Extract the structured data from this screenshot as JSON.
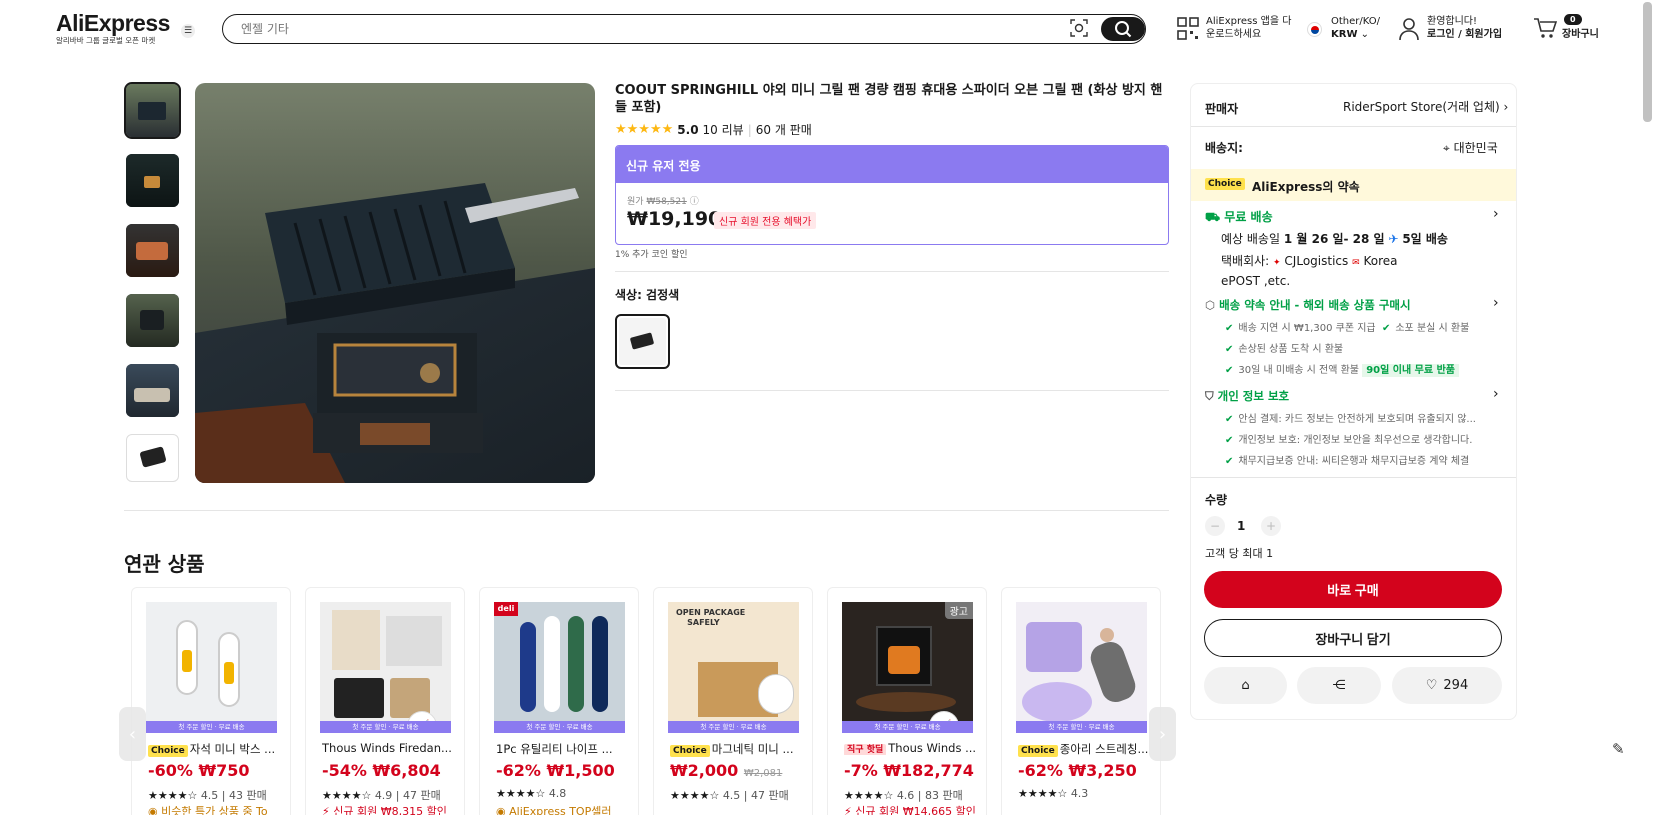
{
  "header": {
    "logo": "AliExpress",
    "logo_sub": "알리바바 그룹 글로벌 오픈 마켓",
    "search_placeholder": "엔젤 기타",
    "app_line1": "AliExpress 앱을 다",
    "app_line2": "운로드하세요",
    "locale_line1": "Other/KO/",
    "locale_currency": "KRW",
    "welcome": "환영합니다!",
    "login": "로그인 / 회원가입",
    "cart_count": "0",
    "cart_label": "장바구니"
  },
  "product": {
    "title": "COOUT SPRINGHILL 야외 미니 그릴 팬 경량 캠핑 휴대용 스파이더 오븐 그릴 팬 (화상 방지 핸들 포함)",
    "rating": "5.0",
    "reviews": "10 리뷰",
    "sold": "60 개 판매",
    "promo_header": "신규 유저 전용",
    "orig_label": "원가",
    "orig_price": "₩58,521",
    "price": "₩19,190",
    "price_tag": "신규 회원 전용 혜택가",
    "coin": "1% 추가 코인 할인",
    "color_label": "색상: 검정색"
  },
  "panel": {
    "seller_label": "판매자",
    "seller_name": "RiderSport Store(거래 업체)",
    "ship_to_label": "배송지:",
    "ship_to": "대한민국",
    "choice_badge": "Choice",
    "promise": "AliExpress의 약속",
    "free_ship": "무료 배송",
    "eta_prefix": "예상 배송일",
    "eta_dates": "1 월 26 일- 28 일",
    "eta_days": "5일 배송",
    "courier_label": "택배회사:",
    "courier1": "CJLogistics",
    "courier2": "Korea",
    "courier3": "ePOST ,etc.",
    "guarantee_title": "배송 약속 안내 - 해외 배송 상품 구매시",
    "g1": "배송 지연 시 ₩1,300 쿠폰 지급",
    "g2": "소포 분실 시 환불",
    "g3": "손상된 상품 도착 시 환불",
    "g4": "30일 내 미배송 시 전액 환불",
    "g4_badge": "90일 이내 무료 반품",
    "privacy_title": "개인 정보 보호",
    "p1": "안심 결제: 카드 정보는 안전하게 보호되며 유출되지 않...",
    "p2": "개인정보 보호: 개인정보 보안을 최우선으로 생각합니다.",
    "p3": "채무지급보증 안내: 씨티은행과 채무지급보증 계약 체결",
    "qty_label": "수량",
    "qty_value": "1",
    "qty_limit": "고객 당 최대 1",
    "buy_now": "바로 구매",
    "add_cart": "장바구니 담기",
    "wish_count": "294"
  },
  "related": {
    "title": "연관 상품",
    "strip": "첫 주문 할인 · 무료 배송",
    "ad_badge": "광고",
    "items": [
      {
        "choice": "Choice",
        "name": "자석 미니 박스 ...",
        "discount": "-60%",
        "price": "₩750",
        "rating": "4.5",
        "sold": "43 판매",
        "extra": "비슷한 특가 상품 중 To"
      },
      {
        "choice": "",
        "name": "Thous Winds Firedan...",
        "discount": "-54%",
        "price": "₩6,804",
        "rating": "4.9",
        "sold": "47 판매",
        "extra": "신규 회원 ₩8,315 할인"
      },
      {
        "choice": "",
        "name": "1Pc 유틸리티 나이프 ...",
        "discount": "-62%",
        "price": "₩1,500",
        "rating": "4.8",
        "sold": "",
        "extra": "AliExpress TOP셀러"
      },
      {
        "choice": "Choice",
        "name": "마그네틱 미니 ...",
        "discount": "",
        "price": "₩2,000",
        "orig": "₩2,081",
        "rating": "4.5",
        "sold": "47 판매",
        "extra": ""
      },
      {
        "choice": "직구 핫딜",
        "name": "Thous Winds ...",
        "discount": "-7%",
        "price": "₩182,774",
        "rating": "4.6",
        "sold": "83 판매",
        "extra": "신규 회원 ₩14,665 할인"
      },
      {
        "choice": "Choice",
        "name": "종아리 스트레칭...",
        "discount": "-62%",
        "price": "₩3,250",
        "rating": "4.3",
        "sold": "",
        "extra": ""
      }
    ]
  }
}
